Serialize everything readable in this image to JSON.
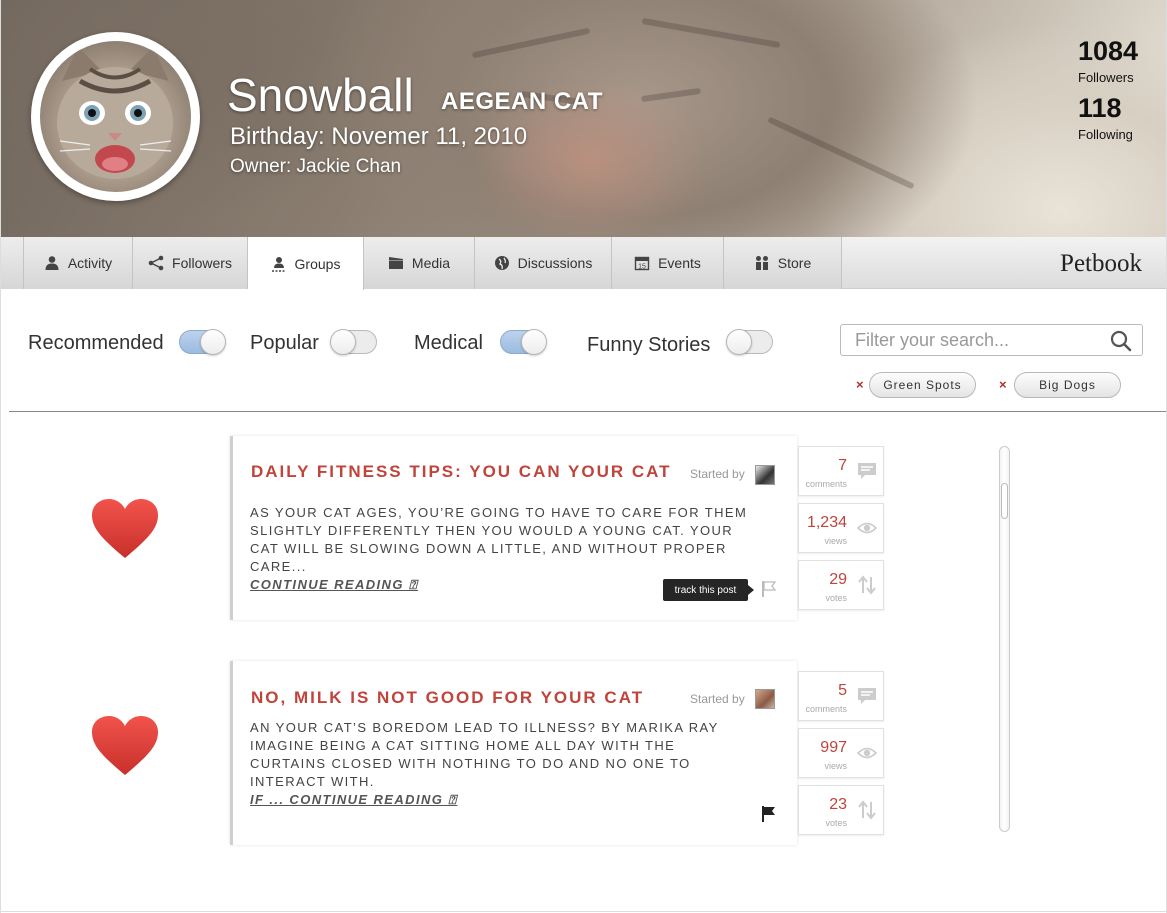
{
  "profile": {
    "name": "Snowball",
    "breed": "AEGEAN CAT",
    "birthday": "Birthday: Novemer 11, 2010",
    "owner": "Owner: Jackie Chan",
    "followers_count": "1084",
    "followers_label": "Followers",
    "following_count": "118",
    "following_label": "Following"
  },
  "nav": {
    "tabs": [
      {
        "label": "Activity",
        "icon": "person-icon"
      },
      {
        "label": "Followers",
        "icon": "share-icon"
      },
      {
        "label": "Groups",
        "icon": "group-icon",
        "active": true
      },
      {
        "label": "Media",
        "icon": "clapperboard-icon"
      },
      {
        "label": "Discussions",
        "icon": "globe-icon"
      },
      {
        "label": "Events",
        "icon": "calendar-icon"
      },
      {
        "label": "Store",
        "icon": "people-icon"
      }
    ],
    "brand": "Petbook",
    "calendar_day": "15"
  },
  "filters": {
    "toggles": [
      {
        "label": "Recommended",
        "on": true
      },
      {
        "label": "Popular",
        "on": false
      },
      {
        "label": "Medical",
        "on": true
      },
      {
        "label": "Funny Stories",
        "on": false
      }
    ],
    "search_placeholder": "Filter your search...",
    "chips": [
      {
        "remove": "×",
        "label": "Green Spots"
      },
      {
        "remove": "×",
        "label": "Big Dogs"
      }
    ]
  },
  "posts": [
    {
      "title": "DAILY FITNESS TIPS: YOU CAN YOUR CAT",
      "started_by": "Started by",
      "excerpt": "AS YOUR CAT AGES, YOU’RE GOING TO HAVE TO CARE FOR THEM SLIGHTLY DIFFERENTLY THEN YOU WOULD A YOUNG CAT. YOUR CAT WILL BE SLOWING DOWN A LITTLE, AND WITHOUT PROPER CARE...",
      "continue": "CONTINUE READING ⍰",
      "tooltip": "track this post",
      "comments": "7",
      "comments_label": "comments",
      "views": "1,234",
      "views_label": "views",
      "votes": "29",
      "votes_label": "votes"
    },
    {
      "title": "NO, MILK IS NOT GOOD FOR YOUR CAT",
      "started_by": "Started by",
      "excerpt": "AN YOUR CAT’S BOREDOM LEAD TO ILLNESS? BY MARIKA RAY IMAGINE BEING A CAT SITTING HOME ALL DAY WITH THE CURTAINS CLOSED WITH NOTHING TO DO AND NO ONE TO INTERACT WITH.",
      "continue": " IF ... CONTINUE READING ⍰",
      "comments": "5",
      "comments_label": "comments",
      "views": "997",
      "views_label": "views",
      "votes": "23",
      "votes_label": "votes"
    }
  ],
  "colors": {
    "accent": "#c0443b",
    "heart": "#e23b3b"
  }
}
